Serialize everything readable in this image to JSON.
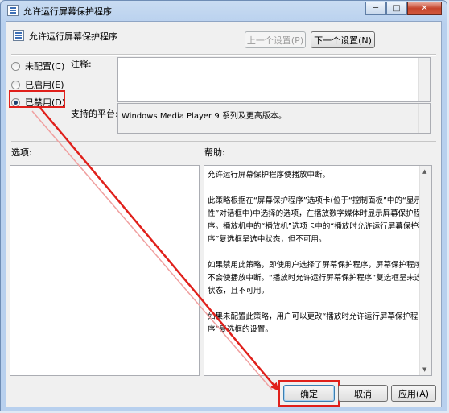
{
  "window": {
    "title": "允许运行屏幕保护程序",
    "caption": {
      "minimize": "─",
      "maximize": "□",
      "close": "✕"
    }
  },
  "header": {
    "policy_title": "允许运行屏幕保护程序",
    "prev_button": "上一个设置(P)",
    "next_button": "下一个设置(N)"
  },
  "options": [
    {
      "label": "未配置(C)",
      "checked": false
    },
    {
      "label": "已启用(E)",
      "checked": false
    },
    {
      "label": "已禁用(D)",
      "checked": true
    }
  ],
  "comment": {
    "label": "注释:",
    "value": ""
  },
  "platform": {
    "label": "支持的平台:",
    "value": "Windows Media Player 9 系列及更高版本。"
  },
  "options_section": {
    "label": "选项:"
  },
  "help_section": {
    "label": "帮助:",
    "paragraphs": [
      "允许运行屏幕保护程序使播放中断。",
      "此策略根据在“屏幕保护程序”选项卡(位于“控制面板”中的“显示属性”对话框中)中选择的选项，在播放数字媒体时显示屏幕保护程序。播放机中的“播放机”选项卡中的“播放时允许运行屏幕保护程序”复选框呈选中状态，但不可用。",
      "如果禁用此策略，即使用户选择了屏幕保护程序，屏幕保护程序也不会使播放中断。“播放时允许运行屏幕保护程序”复选框呈未选中状态，且不可用。",
      "如果未配置此策略，用户可以更改“播放时允许运行屏幕保护程序”复选框的设置。"
    ]
  },
  "footer": {
    "ok_button": "确定",
    "cancel_button": "取消",
    "apply_button": "应用(A)"
  },
  "colors": {
    "annotation": "#e0201b"
  }
}
